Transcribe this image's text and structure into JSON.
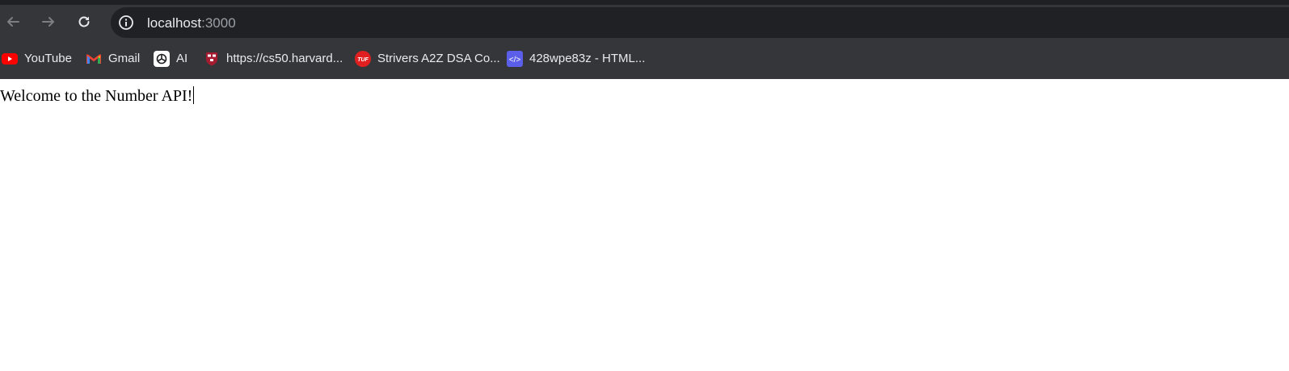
{
  "browser": {
    "nav": {
      "back_icon": "back-arrow-icon",
      "forward_icon": "forward-arrow-icon",
      "reload_icon": "reload-icon",
      "site_info_icon": "info-icon"
    },
    "address_bar": {
      "host": "localhost",
      "port": ":3000"
    },
    "bookmarks": [
      {
        "label": "YouTube",
        "icon": "youtube-icon"
      },
      {
        "label": "Gmail",
        "icon": "gmail-icon"
      },
      {
        "label": "AI",
        "icon": "openai-icon"
      },
      {
        "label": "https://cs50.harvard...",
        "icon": "harvard-shield-icon"
      },
      {
        "label": "Strivers A2Z DSA Co...",
        "icon": "tuf-icon",
        "icon_text": "TUF"
      },
      {
        "label": "428wpe83z - HTML...",
        "icon": "code-icon",
        "icon_text": "</>"
      }
    ],
    "colors": {
      "chrome": "#35363a",
      "omnibox": "#202124",
      "text": "#e8eaed"
    }
  },
  "page": {
    "welcome_text": "Welcome to the Number API!"
  }
}
